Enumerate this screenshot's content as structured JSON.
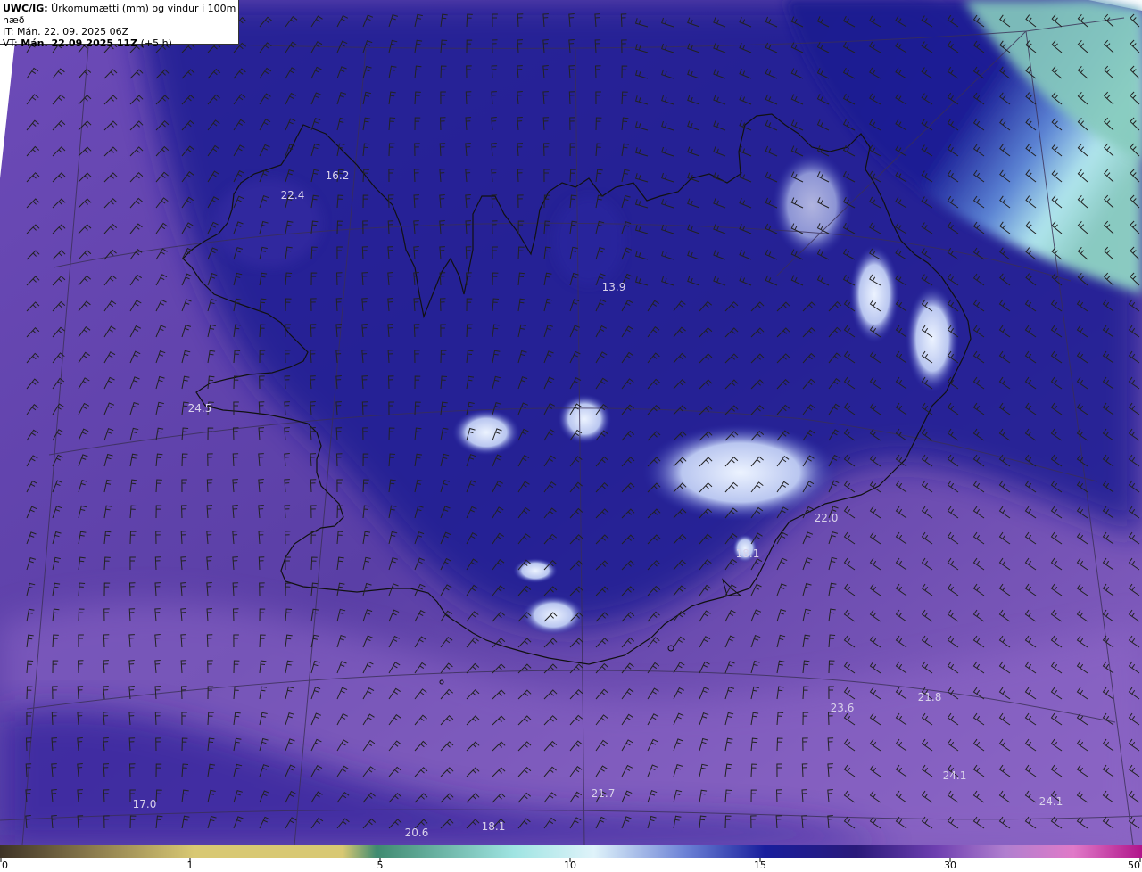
{
  "header": {
    "model_prefix": "UWC/IG:",
    "product": " Úrkomumætti (mm) og vindur i 100m hæð",
    "it_line": "IT: Mán. 22. 09. 2025 06Z",
    "vt_prefix": "VT: ",
    "vt_bold": "Mán. 22.09.2025 11Z",
    "vt_suffix": " (+5 h)"
  },
  "map_values": [
    {
      "label": "16.2"
    },
    {
      "label": "22.4"
    },
    {
      "label": "13.9"
    },
    {
      "label": "24.5"
    },
    {
      "label": "22.0"
    },
    {
      "label": "18.1"
    },
    {
      "label": "23.6"
    },
    {
      "label": "21.8"
    },
    {
      "label": "24.1"
    },
    {
      "label": "24.1"
    },
    {
      "label": "21.7"
    },
    {
      "label": "17.0"
    },
    {
      "label": "20.6"
    },
    {
      "label": "18.1"
    }
  ],
  "colorbar": {
    "ticks": [
      "0",
      "1",
      "5",
      "10",
      "15",
      "30",
      "50"
    ],
    "colors": [
      "#3d3326",
      "#8a7a4c",
      "#d8c873",
      "#3f8a70",
      "#9fe4e2",
      "#dff3fa",
      "#6c82d6",
      "#191e9c",
      "#2a1a7a",
      "#6e3fb0",
      "#b07fcf",
      "#e07ac8",
      "#b0148a"
    ]
  },
  "colors": {
    "sea_base": "#5a3fa6",
    "band_deep": "#1b1d8f",
    "band_light": "#a6ecef",
    "ne_teal": "#8fd3c4",
    "coast": "#111111",
    "barb": "#222222"
  }
}
